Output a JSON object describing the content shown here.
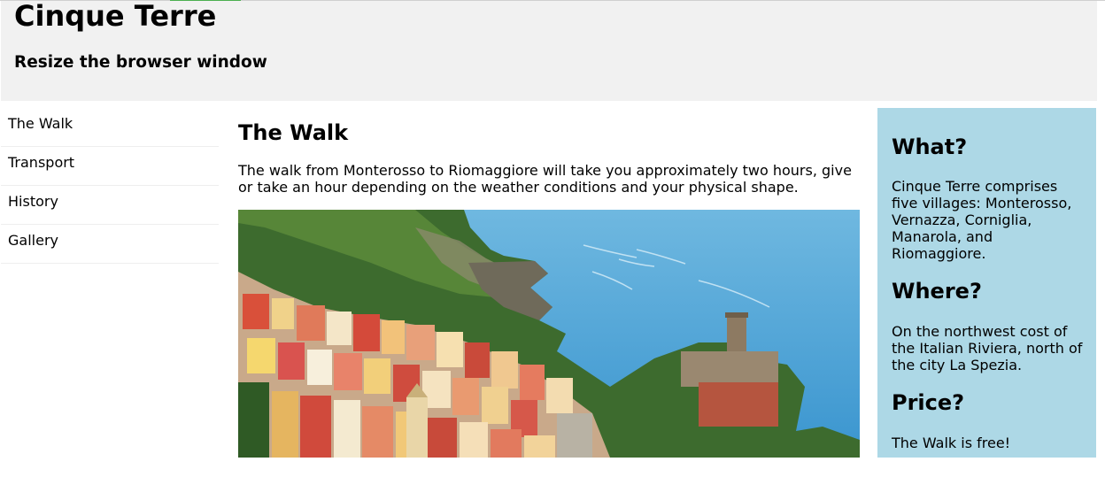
{
  "header": {
    "title": "Cinque Terre",
    "subtitle": "Resize the browser window"
  },
  "menu": {
    "items": [
      "The Walk",
      "Transport",
      "History",
      "Gallery"
    ]
  },
  "main": {
    "heading": "The Walk",
    "paragraph": "The walk from Monterosso to Riomaggiore will take you approximately two hours, give or take an hour depending on the weather conditions and your physical shape."
  },
  "aside": {
    "what_heading": "What?",
    "what_text": "Cinque Terre comprises five villages: Monterosso, Vernazza, Corniglia, Manarola, and Riomaggiore.",
    "where_heading": "Where?",
    "where_text": "On the northwest cost of the Italian Riviera, north of the city La Spezia.",
    "price_heading": "Price?",
    "price_text": "The Walk is free!"
  },
  "colors": {
    "header_bg": "#f1f1f1",
    "aside_bg": "#add8e6",
    "menu_divider": "#eeeeee",
    "sea": "#3f9fd3"
  }
}
